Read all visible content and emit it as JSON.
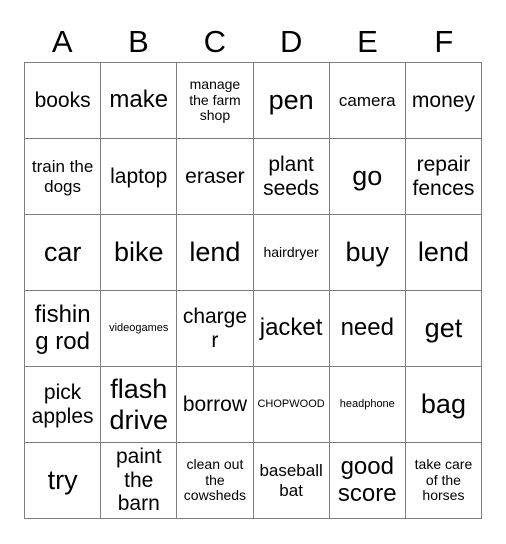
{
  "card": {
    "type": "bingo-card",
    "columns": 6,
    "rows": 6,
    "border_color": "#808080",
    "text_color": "#000000",
    "background_color": "#ffffff",
    "column_headers": [
      "A",
      "B",
      "C",
      "D",
      "E",
      "F"
    ],
    "cells": [
      [
        {
          "text": "books",
          "size": "l"
        },
        {
          "text": "make",
          "size": "xl"
        },
        {
          "text": "manage the farm shop",
          "size": "s"
        },
        {
          "text": "pen",
          "size": "xxl"
        },
        {
          "text": "camera",
          "size": "m"
        },
        {
          "text": "money",
          "size": "l"
        }
      ],
      [
        {
          "text": "train the dogs",
          "size": "m"
        },
        {
          "text": "laptop",
          "size": "l"
        },
        {
          "text": "eraser",
          "size": "l"
        },
        {
          "text": "plant seeds",
          "size": "l"
        },
        {
          "text": "go",
          "size": "xxl"
        },
        {
          "text": "repair fences",
          "size": "l"
        }
      ],
      [
        {
          "text": "car",
          "size": "xxl"
        },
        {
          "text": "bike",
          "size": "xxl"
        },
        {
          "text": "lend",
          "size": "xxl"
        },
        {
          "text": "hairdryer",
          "size": "s"
        },
        {
          "text": "buy",
          "size": "xxl"
        },
        {
          "text": "lend",
          "size": "xxl"
        }
      ],
      [
        {
          "text": "fishing rod",
          "size": "xl"
        },
        {
          "text": "videogames",
          "size": "xs"
        },
        {
          "text": "charger",
          "size": "l"
        },
        {
          "text": "jacket",
          "size": "xl"
        },
        {
          "text": "need",
          "size": "xl"
        },
        {
          "text": "get",
          "size": "xxl"
        }
      ],
      [
        {
          "text": "pick apples",
          "size": "l"
        },
        {
          "text": "flash drive",
          "size": "xxl"
        },
        {
          "text": "borrow",
          "size": "l"
        },
        {
          "text": "CHOPWOOD",
          "size": "xs"
        },
        {
          "text": "headphone",
          "size": "xs"
        },
        {
          "text": "bag",
          "size": "xxl"
        }
      ],
      [
        {
          "text": "try",
          "size": "xxl"
        },
        {
          "text": "paint the barn",
          "size": "l"
        },
        {
          "text": "clean out the cowsheds",
          "size": "s"
        },
        {
          "text": "baseball bat",
          "size": "m"
        },
        {
          "text": "good score",
          "size": "xl"
        },
        {
          "text": "take care of the horses",
          "size": "s"
        }
      ]
    ]
  }
}
